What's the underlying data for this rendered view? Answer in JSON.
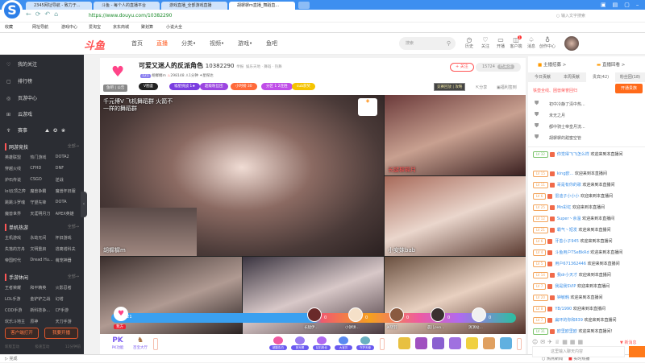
{
  "browser": {
    "tabs": [
      {
        "label": "2345网址导航 - 致力于..."
      },
      {
        "label": "斗鱼 - 每个人的直播平台"
      },
      {
        "label": "游戏直播_全部游戏直播"
      },
      {
        "label": "胡樨樨m直播_舞蹈直..."
      }
    ],
    "url": "https://www.douyu.com/10382290",
    "search_placeholder": "输入文字搜索",
    "bookmarks": [
      "收藏",
      "网址导航",
      "游戏中心",
      "爱淘宝",
      "京东商城",
      "聚划算",
      "小说大全"
    ],
    "status": "完成"
  },
  "site": {
    "logo": "斗鱼",
    "nav": [
      "首页",
      "直播",
      "分类•",
      "视频•",
      "游戏•",
      "鱼吧"
    ],
    "search_placeholder": "搜索",
    "icons": [
      {
        "icon": "history-icon",
        "label": "历史"
      },
      {
        "icon": "follow-icon",
        "label": "关注"
      },
      {
        "icon": "live-icon",
        "label": "开播"
      },
      {
        "icon": "client-icon",
        "label": "客户端",
        "badge": "1"
      },
      {
        "icon": "bell-icon",
        "label": "消息"
      },
      {
        "icon": "creator-icon",
        "label": "创作中心"
      }
    ]
  },
  "sidebar": {
    "items": [
      "我的关注",
      "排行榜",
      "页游中心",
      "云游戏",
      "赛事"
    ],
    "sections": [
      {
        "title": "网游竞技",
        "more": "全部→",
        "games": [
          "英雄联盟",
          "热门游戏",
          "DOTA2",
          "穿越火线",
          "CFHD",
          "DNF",
          "炉石传说",
          "CSGO",
          "逆战",
          "lol云顶之弈",
          "魔兽争霸",
          "魔兽怀旧服",
          "跳跳斗罗魂",
          "守望先锋",
          "DOTA",
          "魔兽世界",
          "天涯明月刀",
          "APEX英雄"
        ]
      },
      {
        "title": "单机热游",
        "more": "全部→",
        "games": [
          "主机游戏",
          "永劫无间",
          "怀旧游戏",
          "失落的方舟",
          "文明重启",
          "逃离塔科夫",
          "帝国时代",
          "Dread Hu...",
          "萌宠神器"
        ]
      },
      {
        "title": "手游休闲",
        "more": "全部→",
        "games": [
          "王者荣耀",
          "和平精英",
          "火影忍者",
          "LOL手游",
          "金铲铲之战",
          "幻塔",
          "COD手游",
          "新科技争...",
          "CF手游",
          "欢乐斗地主",
          "原神",
          "天刀手游"
        ]
      }
    ],
    "buttons": [
      "客户端打开",
      "我要开播"
    ],
    "footer": [
      "新版互动",
      "极速互动",
      "12分钟前"
    ]
  },
  "room": {
    "title": "可爱又迷人的反派角色",
    "room_id": "10382290",
    "report": "举报",
    "category": "娱乐天地 · 舞蹈 · 热舞",
    "anchor_level": "121",
    "anchor": "胡樨樨m",
    "heat": "298148",
    "fans": "1分钟",
    "rank": "星探达",
    "badges": [
      "鱼吧 | 公告"
    ],
    "chips": [
      {
        "label": "V图鉴",
        "color": "#222"
      },
      {
        "label": "福星挑战 1★",
        "color": "#7a3ee0"
      },
      {
        "label": "超级粉丝团",
        "color": "#9b45e0"
      },
      {
        "label": "小时榜 30",
        "color": "#ff6a3a"
      },
      {
        "label": "分区 1 2连胜",
        "color": "#c04ee8"
      },
      {
        "label": "sub获奖",
        "color": "#f5c400"
      }
    ],
    "follow_label": "+ 关注",
    "follow_count": "15724",
    "member_label": "已关注",
    "share": "分享",
    "clip": "福利签到",
    "live_tag": "竞赛回放 | 攻略"
  },
  "video": {
    "tiles": [
      {
        "name": "千元博V 飞机舞蹈群 火箭不一样的舞蹈群"
      },
      {
        "name": "长腿樨樨月"
      },
      {
        "name": "胡樨樨m"
      },
      {
        "name": "小安妹bab"
      },
      {
        "name": ""
      },
      {
        "name": ""
      },
      {
        "name": ""
      }
    ],
    "pk": {
      "left_score": "121",
      "left_label": "我方",
      "participants": [
        {
          "name": "长腿伊...",
          "score": "0"
        },
        {
          "name": "小饼饼...",
          "score": "0"
        },
        {
          "name": "关晓羽",
          "score": "0"
        },
        {
          "name": "晨儿ovo...",
          "score": "0"
        },
        {
          "name": "演演站...",
          "score": "0"
        }
      ]
    }
  },
  "gifts": {
    "left": [
      "PK功能",
      "百宝大厅"
    ],
    "center": [
      "超能告白",
      "荧光棒",
      "钻石粉丝",
      "大宝贝",
      "守护天使"
    ]
  },
  "chat": {
    "top_links": [
      "主播招募 >",
      "直播回看 >"
    ],
    "tabs": [
      "今日贡献",
      "本周贡献",
      "贵宾(42)",
      "粉丝团(18)"
    ],
    "notice": "铁壶全线、困兽荣誉回归",
    "open_noble": "开通贵族",
    "nobles": [
      "初中冷静了清中热...",
      "未无之月",
      "都中骑士帝皇月流...",
      "胡樨樨的甜蜜空管"
    ],
    "messages": [
      {
        "lv": "LV 32",
        "name": "你觉得飞飞怎么样",
        "text": "欢迎来到本直播间",
        "g": true
      },
      {
        "lv": "LV 15",
        "name": "king欧...",
        "text": "欢迎来到本直播间"
      },
      {
        "lv": "LV 11",
        "name": "哥是有你的歌",
        "text": "欢迎来到本直播间"
      },
      {
        "lv": "LV 6",
        "name": "雷迪子小小小",
        "text": "欢迎来到本直播间"
      },
      {
        "lv": "LV 25",
        "name": "Mn彩虹",
        "text": "欢迎来到本直播间"
      },
      {
        "lv": "LV 12",
        "name": "Super丶余温",
        "text": "欢迎来到本直播间"
      },
      {
        "lv": "LV 21",
        "name": "霸气丶短发",
        "text": "欢迎来到本直播间"
      },
      {
        "lv": "LV 6",
        "name": "牙善小子945",
        "text": "欢迎来到本直播间"
      },
      {
        "lv": "LV 4",
        "name": "斗鱼用户TSeBkRd",
        "text": "欢迎来到本直播间"
      },
      {
        "lv": "LV 5",
        "name": "用户671362446",
        "text": "欢迎来到本直播间"
      },
      {
        "lv": "LV 14",
        "name": "我dr小天才",
        "text": "欢迎来到本直播间"
      },
      {
        "lv": "LV 7",
        "name": "我是我SVIP",
        "text": "欢迎来到本直播间"
      },
      {
        "lv": "LV 20",
        "name": "钟敏韩",
        "text": "欢迎来到本直播间"
      },
      {
        "lv": "LV 8",
        "name": "YB/1990",
        "text": "欢迎来到本直播间"
      },
      {
        "lv": "LV 7",
        "name": "扁环的你和839",
        "text": "欢迎来到本直播间"
      },
      {
        "lv": "LV 31",
        "name": "欧里欧里欧",
        "text": "欢迎来到本直播间！",
        "g": true
      }
    ],
    "new_msg": "新消息",
    "input_placeholder": "这里输入聊天内容",
    "bottom": [
      "热点新闻",
      "实时热播"
    ]
  }
}
